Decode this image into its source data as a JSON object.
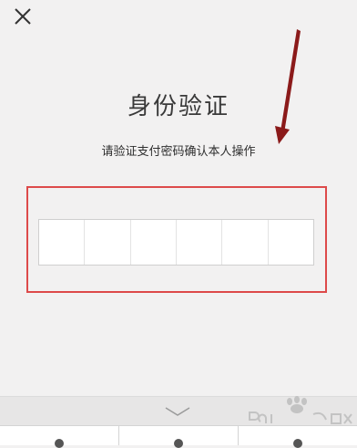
{
  "header": {
    "close_icon": "close-icon"
  },
  "main": {
    "title": "身份验证",
    "subtitle": "请验证支付密码确认本人操作"
  },
  "pin": {
    "length": 6
  },
  "keyboard": {
    "collapse_icon": "chevron-down-icon"
  },
  "colors": {
    "annotation_red": "#dd4a4a",
    "arrow_dark_red": "#8b1a1a"
  }
}
